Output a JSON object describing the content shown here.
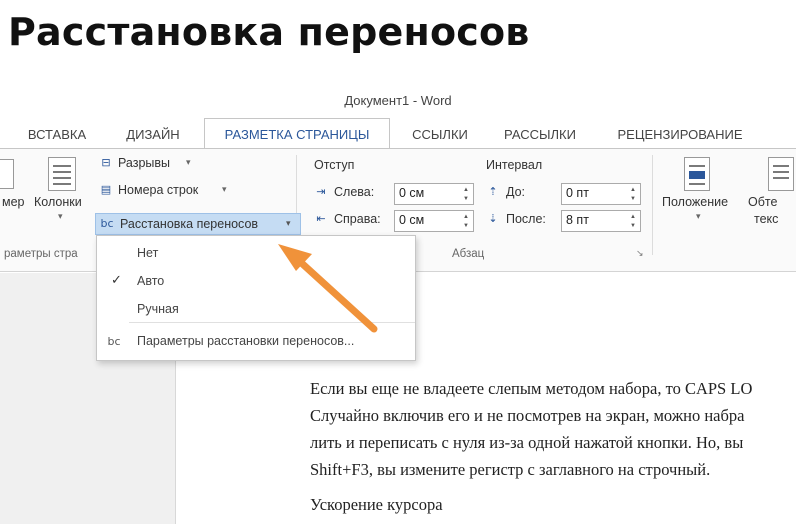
{
  "heading": "Расстановка переносов",
  "window": {
    "title": "Документ1 - Word"
  },
  "tabs": [
    {
      "label": "ВСТАВКА"
    },
    {
      "label": "ДИЗАЙН"
    },
    {
      "label": "РАЗМЕТКА СТРАНИЦЫ",
      "active": true
    },
    {
      "label": "ССЫЛКИ"
    },
    {
      "label": "РАССЫЛКИ"
    },
    {
      "label": "РЕЦЕНЗИРОВАНИЕ"
    }
  ],
  "ribbon": {
    "page_setup": {
      "size_label": "мер",
      "columns_label": "Колонки",
      "breaks_label": "Разрывы",
      "line_numbers_label": "Номера строк",
      "hyphenation_label": "Расстановка переносов",
      "group_label": "раметры стра"
    },
    "paragraph": {
      "indent_header": "Отступ",
      "left_label": "Слева:",
      "left_value": "0 см",
      "right_label": "Справа:",
      "right_value": "0 см",
      "spacing_header": "Интервал",
      "before_label": "До:",
      "before_value": "0 пт",
      "after_label": "После:",
      "after_value": "8 пт",
      "group_label": "Абзац"
    },
    "arrange": {
      "position_label": "Положение",
      "wrap_label_1": "Обте",
      "wrap_label_2": "текс"
    }
  },
  "menu": {
    "items": [
      {
        "label": "Нет"
      },
      {
        "label": "Авто",
        "checked": true
      },
      {
        "label": "Ручная"
      }
    ],
    "options_label": "Параметры расстановки переносов..."
  },
  "document": {
    "lines": [
      "Если вы еще не владеете слепым методом набора, то CAPS LO",
      "Случайно включив его и не посмотрев на экран, можно набра",
      "лить и переписать с нуля из-за одной нажатой кнопки. Но, вы",
      "Shift+F3, вы измените регистр с заглавного на строчный.",
      "Ускорение курсора"
    ]
  },
  "colors": {
    "accent": "#2b579a",
    "highlight": "#c5dcf3",
    "arrow": "#f0923a"
  }
}
